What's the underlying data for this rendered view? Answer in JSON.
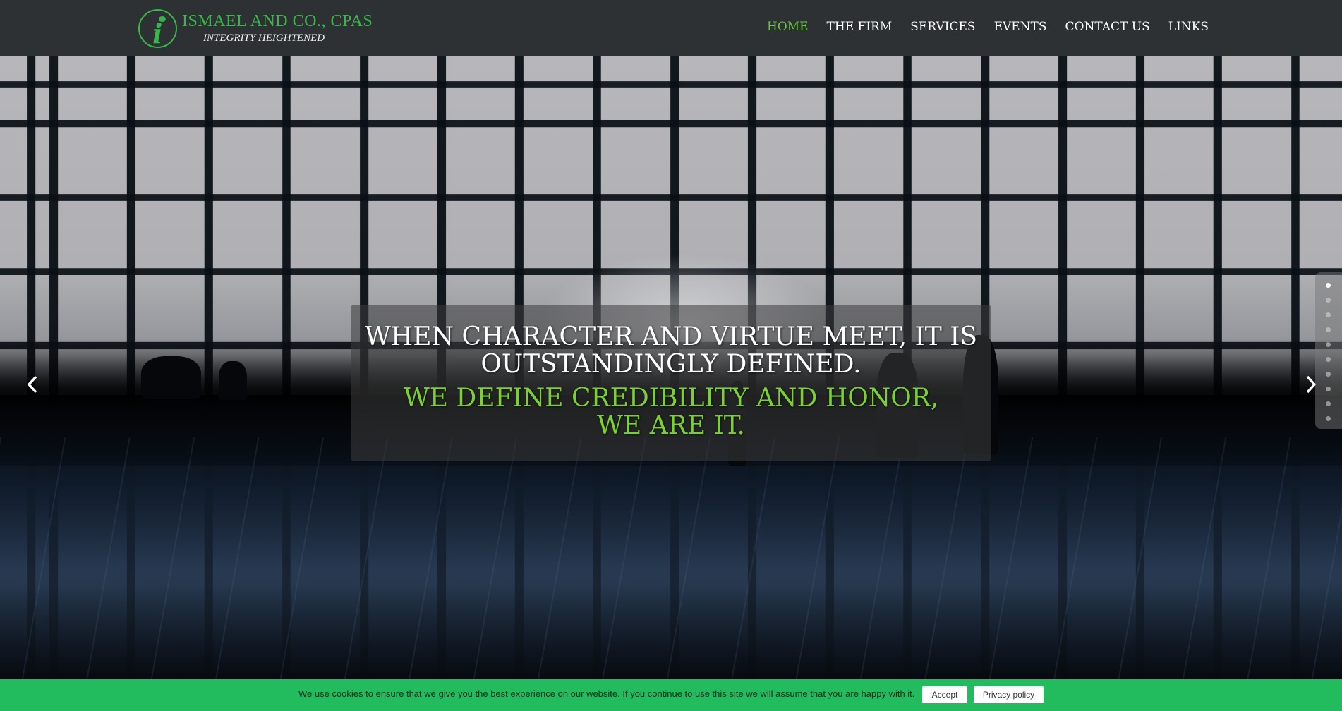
{
  "header": {
    "logo_name": "ISMAEL AND CO., CPAS",
    "logo_tagline": "INTEGRITY HEIGHTENED",
    "logo_letter": "i",
    "brand_color": "#3ab54a"
  },
  "nav": {
    "items": [
      {
        "label": "HOME",
        "active": true
      },
      {
        "label": "THE FIRM",
        "active": false
      },
      {
        "label": "SERVICES",
        "active": false
      },
      {
        "label": "EVENTS",
        "active": false
      },
      {
        "label": "CONTACT US",
        "active": false
      },
      {
        "label": "LINKS",
        "active": false
      }
    ],
    "active_color": "#6cc33f"
  },
  "slider": {
    "headline_line1": "WHEN CHARACTER AND VIRTUE MEET, IT IS",
    "headline_line2": "OUTSTANDINGLY DEFINED.",
    "subline_line1": "WE DEFINE CREDIBILITY AND HONOR,",
    "subline_line2": "WE ARE IT.",
    "accent_color": "#7bd134",
    "prev_icon": "chevron-left-icon",
    "next_icon": "chevron-right-icon",
    "slide_count": 10,
    "active_slide": 1
  },
  "cookie_bar": {
    "text": "We use cookies to ensure that we give you the best experience on our website. If you continue to use this site we will assume that you are happy with it.",
    "accept_label": "Accept",
    "privacy_label": "Privacy policy",
    "background_color": "#22bb5e"
  }
}
